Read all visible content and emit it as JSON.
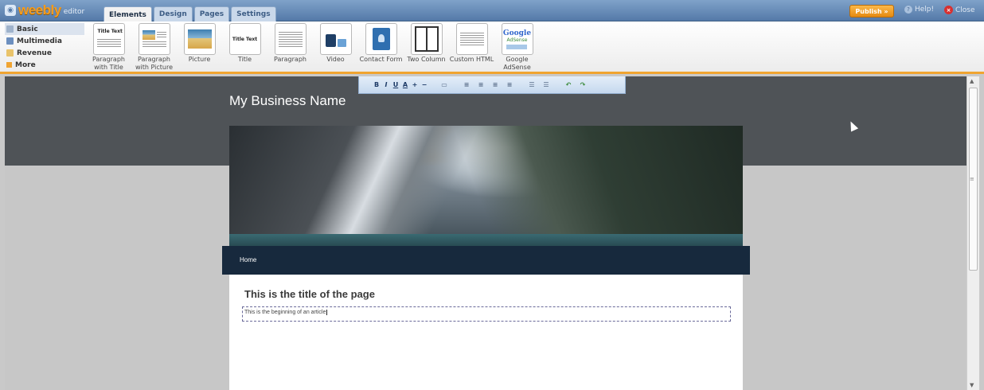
{
  "app": {
    "logo_text": "weebly",
    "logo_sub": "editor",
    "tabs": [
      {
        "label": "Elements",
        "active": true
      },
      {
        "label": "Design",
        "active": false
      },
      {
        "label": "Pages",
        "active": false
      },
      {
        "label": "Settings",
        "active": false
      }
    ],
    "publish_label": "Publish »",
    "help_label": "Help!",
    "close_label": "Close",
    "accent_color": "#f0a431",
    "brand_color": "#5479a8"
  },
  "categories": [
    {
      "label": "Basic",
      "icon": "text-icon"
    },
    {
      "label": "Multimedia",
      "icon": "media-icon"
    },
    {
      "label": "Revenue",
      "icon": "revenue-icon"
    },
    {
      "label": "More",
      "icon": "more-arrow-icon"
    }
  ],
  "elements": [
    {
      "label": "Paragraph with Title",
      "icon": "paragraph-with-title-icon",
      "thumb_text": "Title Text"
    },
    {
      "label": "Paragraph with Picture",
      "icon": "paragraph-with-picture-icon"
    },
    {
      "label": "Picture",
      "icon": "picture-icon"
    },
    {
      "label": "Title",
      "icon": "title-icon",
      "thumb_text": "Title Text"
    },
    {
      "label": "Paragraph",
      "icon": "paragraph-icon"
    },
    {
      "label": "Video",
      "icon": "video-icon"
    },
    {
      "label": "Contact Form",
      "icon": "contact-form-icon"
    },
    {
      "label": "Two Column",
      "icon": "two-column-icon"
    },
    {
      "label": "Custom HTML",
      "icon": "custom-html-icon"
    },
    {
      "label": "Google AdSense",
      "icon": "google-adsense-icon",
      "thumb_text": "Google",
      "thumb_sub": "AdSense"
    }
  ],
  "format_toolbar": {
    "bold": "B",
    "italic": "I",
    "underline": "U",
    "font_color": "A",
    "increase": "+",
    "decrease": "−"
  },
  "site": {
    "title": "My Business Name",
    "nav_items": [
      "Home"
    ],
    "page_title": "This is the title of the page",
    "article_text": "This is the beginning of an article"
  }
}
